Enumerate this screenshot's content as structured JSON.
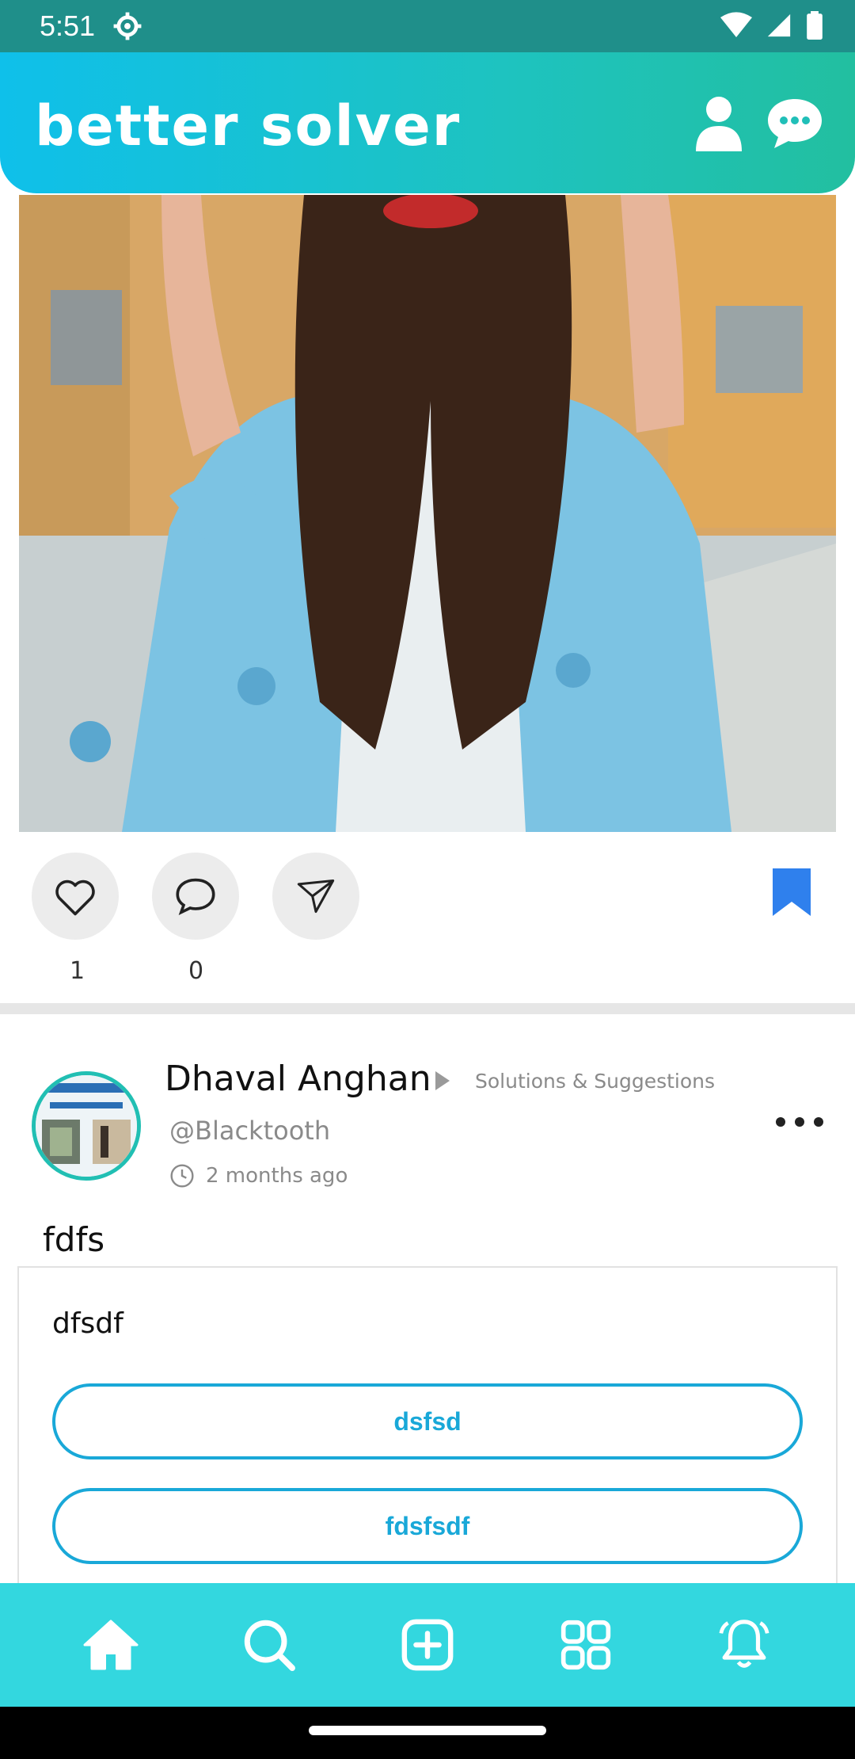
{
  "status_bar": {
    "time": "5:51"
  },
  "header": {
    "title": "better solver"
  },
  "post1": {
    "likes_count": "1",
    "comments_count": "0"
  },
  "post2": {
    "author_name": "Dhaval Anghan",
    "category": "Solutions & Suggestions",
    "handle": "@Blacktooth",
    "time_ago": "2 months ago",
    "title": "fdfs",
    "poll": {
      "question": "dfsdf",
      "options": [
        "dsfsd",
        "fdsfsdf"
      ]
    }
  },
  "colors": {
    "header_start": "#0fc0ea",
    "header_end": "#22bfa0",
    "bottom_nav": "#33d7df",
    "accent_blue": "#19a8d8",
    "bookmark": "#2f80ed"
  },
  "icons": {
    "status": [
      "settings-gear-icon",
      "wifi-icon",
      "signal-icon",
      "battery-icon"
    ],
    "header": [
      "profile-icon",
      "chat-icon"
    ],
    "actions": [
      "heart-icon",
      "comment-icon",
      "share-icon",
      "bookmark-icon"
    ],
    "nav": [
      "home-icon",
      "search-icon",
      "add-post-icon",
      "categories-icon",
      "notifications-icon"
    ]
  }
}
